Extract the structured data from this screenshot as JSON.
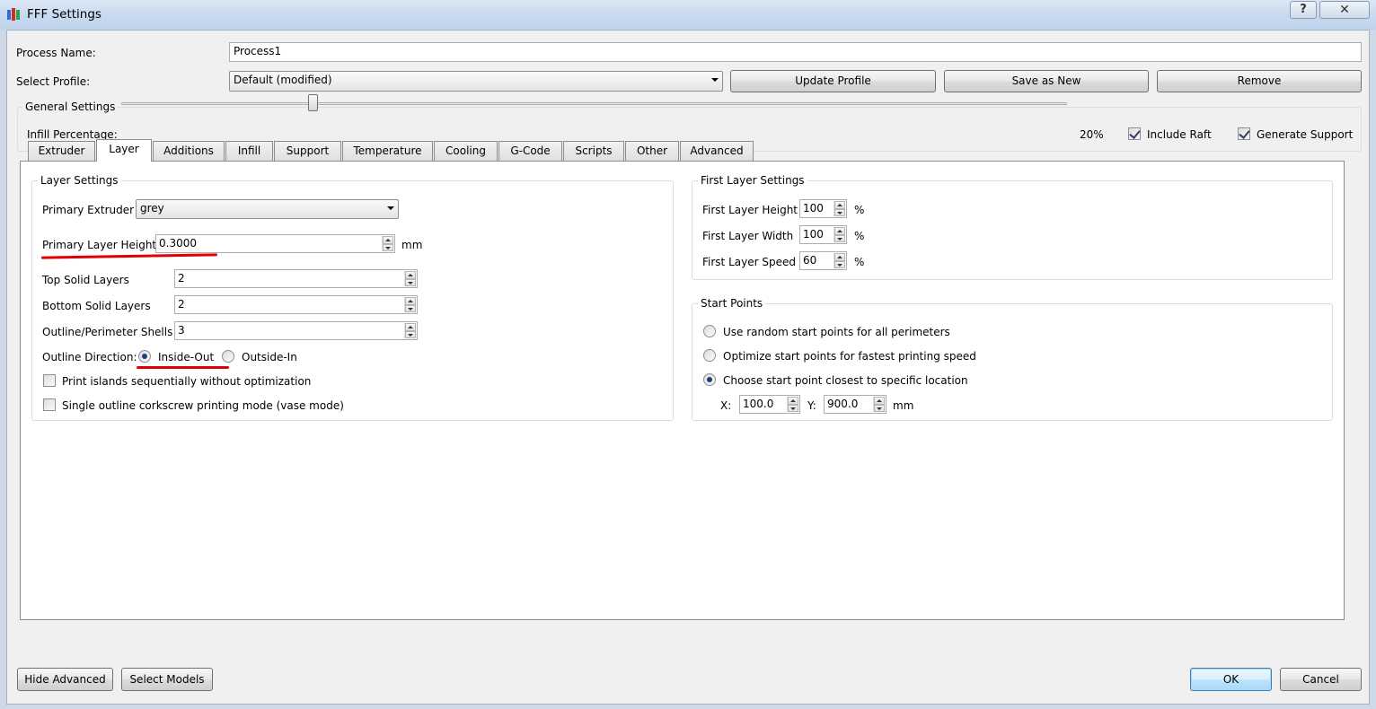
{
  "window": {
    "title": "FFF Settings",
    "help_glyph": "?",
    "close_glyph": "✕"
  },
  "process": {
    "name_label": "Process Name:",
    "name_value": "Process1",
    "profile_label": "Select Profile:",
    "profile_value": "Default (modified)",
    "update_btn": "Update Profile",
    "save_btn": "Save as New",
    "remove_btn": "Remove"
  },
  "general": {
    "title": "General Settings",
    "infill_label": "Infill Percentage:",
    "infill_value": "20%",
    "infill_fraction": 0.2,
    "include_raft_label": "Include Raft",
    "include_raft_checked": true,
    "generate_support_label": "Generate Support",
    "generate_support_checked": true
  },
  "tabs": [
    {
      "label": "Extruder"
    },
    {
      "label": "Layer",
      "active": true
    },
    {
      "label": "Additions"
    },
    {
      "label": "Infill"
    },
    {
      "label": "Support"
    },
    {
      "label": "Temperature"
    },
    {
      "label": "Cooling"
    },
    {
      "label": "G-Code"
    },
    {
      "label": "Scripts"
    },
    {
      "label": "Other"
    },
    {
      "label": "Advanced"
    }
  ],
  "layer_settings": {
    "title": "Layer Settings",
    "primary_extruder_label": "Primary Extruder",
    "primary_extruder_value": "grey",
    "primary_layer_height_label": "Primary Layer Height",
    "primary_layer_height_value": "0.3000",
    "primary_layer_height_unit": "mm",
    "top_solid_label": "Top Solid Layers",
    "top_solid_value": "2",
    "bottom_solid_label": "Bottom Solid Layers",
    "bottom_solid_value": "2",
    "perimeter_label": "Outline/Perimeter Shells",
    "perimeter_value": "3",
    "outline_direction_label": "Outline Direction:",
    "inside_out_label": "Inside-Out",
    "outside_in_label": "Outside-In",
    "print_islands_label": "Print islands sequentially without optimization",
    "vase_mode_label": "Single outline corkscrew printing mode (vase mode)"
  },
  "first_layer": {
    "title": "First Layer Settings",
    "height_label": "First Layer Height",
    "height_value": "100",
    "width_label": "First Layer Width",
    "width_value": "100",
    "speed_label": "First Layer Speed",
    "speed_value": "60",
    "unit": "%"
  },
  "start_points": {
    "title": "Start Points",
    "random_label": "Use random start points for all perimeters",
    "optimize_label": "Optimize start points for fastest printing speed",
    "closest_label": "Choose start point closest to specific location",
    "x_label": "X:",
    "x_value": "100.0",
    "y_label": "Y:",
    "y_value": "900.0",
    "unit": "mm"
  },
  "footer": {
    "hide_advanced": "Hide Advanced",
    "select_models": "Select Models",
    "ok": "OK",
    "cancel": "Cancel"
  },
  "colors": {
    "annotation_red": "#e00000",
    "dialog_bg": "#f0f0f0"
  }
}
